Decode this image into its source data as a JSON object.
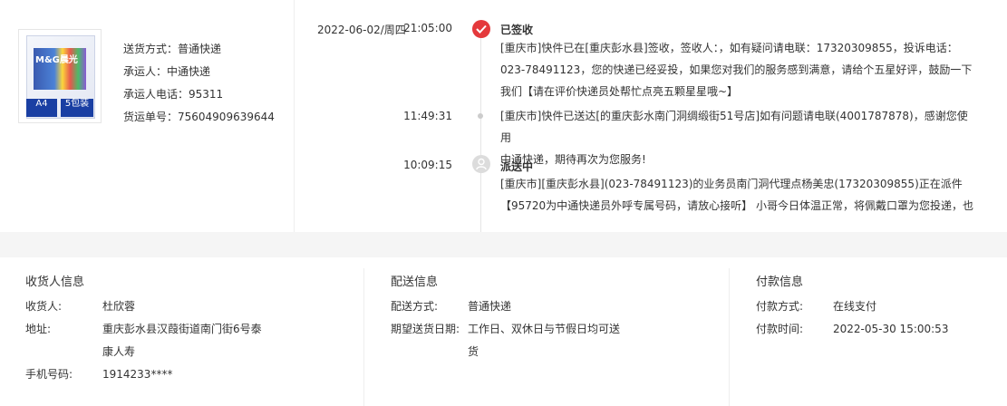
{
  "product": {
    "image_icon": "paper-box-icon",
    "box_logo": "M&G晨光",
    "tag_a4": "A4",
    "tag_a4_sub": "",
    "tag_pack": "5包装",
    "tag_pack_sub": ""
  },
  "shipping": {
    "method": "送货方式：普通快递",
    "carrier": "承运人：中通快递",
    "carrier_phone": "承运人电话：95311",
    "tracking_no": "货运单号：75604909639644"
  },
  "timeline": {
    "date": "2022-06-02/周四",
    "events": [
      {
        "time": "21:05:00",
        "title": "已签收",
        "status_icon": "check-circle-icon",
        "lines": [
          "[重庆市]快件已在[重庆彭水县]签收，签收人：，如有疑问请电联：17320309855，投诉电话：",
          "023-78491123，您的快递已经妥投，如果您对我们的服务感到满意，请给个五星好评，鼓励一下",
          "我们【请在评价快递员处帮忙点亮五颗星星哦~】"
        ]
      },
      {
        "time": "11:49:31",
        "title": "",
        "status_icon": "dot-icon",
        "lines": [
          "[重庆市]快件已送达[的重庆彭水南门洞绸缎街51号店]如有问题请电联(4001787878)，感谢您使用",
          "中通快递，期待再次为您服务!"
        ]
      },
      {
        "time": "10:09:15",
        "title": "派送中",
        "status_icon": "courier-icon",
        "lines": [
          "[重庆市][重庆彭水县](023-78491123)的业务员南门洞代理点杨美忠(17320309855)正在派件",
          "【95720为中通快递员外呼专属号码，请放心接听】 小哥今日体温正常，将佩戴口罩为您投递，也"
        ]
      }
    ]
  },
  "receiver": {
    "heading": "收货人信息",
    "name_label": "收货人:",
    "name": "杜欣蓉",
    "address_label": "地址:",
    "address_line1": "重庆彭水县汉葭街道南门街6号泰",
    "address_line2": "康人寿",
    "phone_label": "手机号码:",
    "phone": "1914233****"
  },
  "delivery": {
    "heading": "配送信息",
    "method_label": "配送方式:",
    "method": "普通快递",
    "date_label": "期望送货日期:",
    "date_line1": "工作日、双休日与节假日均可送",
    "date_line2": "货"
  },
  "payment": {
    "heading": "付款信息",
    "method_label": "付款方式:",
    "method": "在线支付",
    "time_label": "付款时间:",
    "time": "2022-05-30 15:00:53"
  },
  "colors": {
    "accent": "#e4393c",
    "divider": "#eeeeee",
    "page_bg_gap": "#f5f5f5"
  }
}
